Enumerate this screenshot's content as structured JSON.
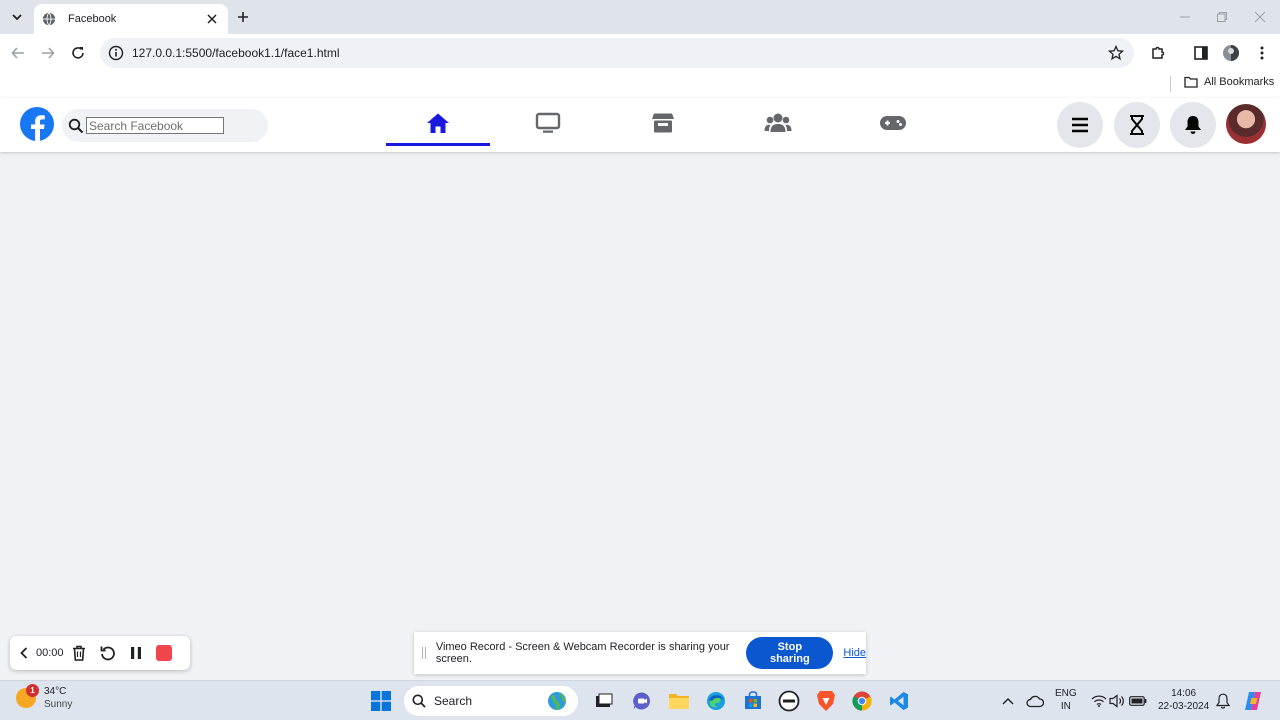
{
  "browser": {
    "tab_title": "Facebook",
    "url": "127.0.0.1:5500/facebook1.1/face1.html",
    "bookmarks_label": "All Bookmarks"
  },
  "facebook": {
    "search_placeholder": "Search Facebook",
    "nav_tabs": [
      {
        "name": "home",
        "icon": "home-icon",
        "active": true
      },
      {
        "name": "watch",
        "icon": "tv-icon",
        "active": false
      },
      {
        "name": "marketplace",
        "icon": "store-icon",
        "active": false
      },
      {
        "name": "groups",
        "icon": "users-icon",
        "active": false
      },
      {
        "name": "gaming",
        "icon": "gamepad-icon",
        "active": false
      }
    ],
    "right_buttons": [
      "menu-icon",
      "hourglass-icon",
      "bell-icon"
    ],
    "accent_color": "#1a1adf",
    "brand_color": "#1877f2"
  },
  "recorder": {
    "time": "00:00"
  },
  "share_bar": {
    "message": "Vimeo Record - Screen & Webcam Recorder is sharing your screen.",
    "stop_label": "Stop sharing",
    "hide_label": "Hide"
  },
  "taskbar": {
    "weather_temp": "34°C",
    "weather_desc": "Sunny",
    "weather_badge": "1",
    "search_label": "Search",
    "lang_line1": "ENG",
    "lang_line2": "IN",
    "time": "14:06",
    "date": "22-03-2024"
  }
}
